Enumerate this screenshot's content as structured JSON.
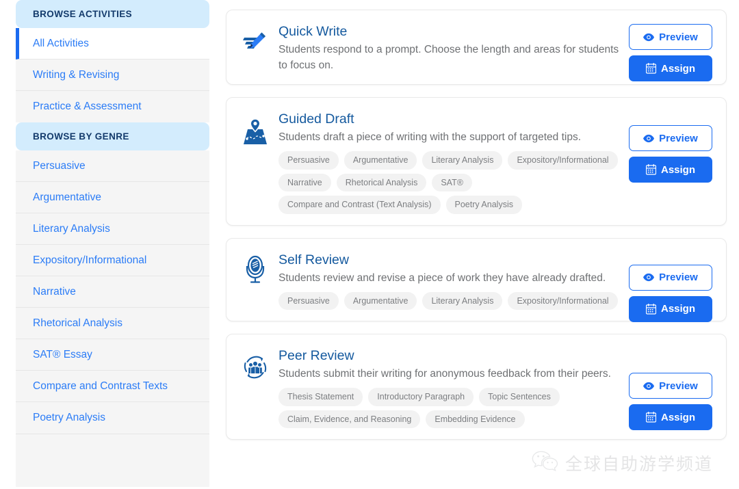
{
  "sidebar": {
    "sections": [
      {
        "header": "BROWSE ACTIVITIES",
        "items": [
          {
            "label": "All Activities",
            "active": true
          },
          {
            "label": "Writing & Revising",
            "active": false
          },
          {
            "label": "Practice & Assessment",
            "active": false
          }
        ]
      },
      {
        "header": "BROWSE BY GENRE",
        "items": [
          {
            "label": "Persuasive",
            "active": false
          },
          {
            "label": "Argumentative",
            "active": false
          },
          {
            "label": "Literary Analysis",
            "active": false
          },
          {
            "label": "Expository/Informational",
            "active": false
          },
          {
            "label": "Narrative",
            "active": false
          },
          {
            "label": "Rhetorical Analysis",
            "active": false
          },
          {
            "label": "SAT® Essay",
            "active": false
          },
          {
            "label": "Compare and Contrast Texts",
            "active": false
          },
          {
            "label": "Poetry Analysis",
            "active": false
          }
        ]
      }
    ]
  },
  "buttons": {
    "preview_label": "Preview",
    "assign_label": "Assign",
    "preview_icon": "eye-icon",
    "assign_icon": "calendar-icon"
  },
  "colors": {
    "accent_blue": "#1a6bf0",
    "link_blue": "#2b7cf6",
    "title_blue": "#14599e",
    "section_header_bg": "#d3ecfd",
    "section_header_text": "#133a6b",
    "tag_bg": "#f2f2f2",
    "tag_text": "#7c7e81",
    "nav_bg": "#f5f5f5",
    "desc_text": "#6e7073"
  },
  "cards": [
    {
      "icon": "pencil-write-icon",
      "title": "Quick Write",
      "description": "Students respond to a prompt. Choose the length and areas for students to focus on.",
      "tags": []
    },
    {
      "icon": "map-pin-icon",
      "title": "Guided Draft",
      "description": "Students draft a piece of writing with the support of targeted tips.",
      "tags": [
        "Persuasive",
        "Argumentative",
        "Literary Analysis",
        "Expository/Informational",
        "Narrative",
        "Rhetorical Analysis",
        "SAT®",
        "Compare and Contrast (Text Analysis)",
        "Poetry Analysis"
      ]
    },
    {
      "icon": "mirror-microphone-icon",
      "title": "Self Review",
      "description": "Students review and revise a piece of work they have already drafted.",
      "tags": [
        "Persuasive",
        "Argumentative",
        "Literary Analysis",
        "Expository/Informational"
      ]
    },
    {
      "icon": "peer-group-refresh-icon",
      "title": "Peer Review",
      "description": "Students submit their writing for anonymous feedback from their peers.",
      "tags": [
        "Thesis Statement",
        "Introductory Paragraph",
        "Topic Sentences",
        "Claim, Evidence, and Reasoning",
        "Embedding Evidence"
      ]
    }
  ],
  "watermark": {
    "text": "全球自助游学频道",
    "icon": "wechat-icon"
  }
}
